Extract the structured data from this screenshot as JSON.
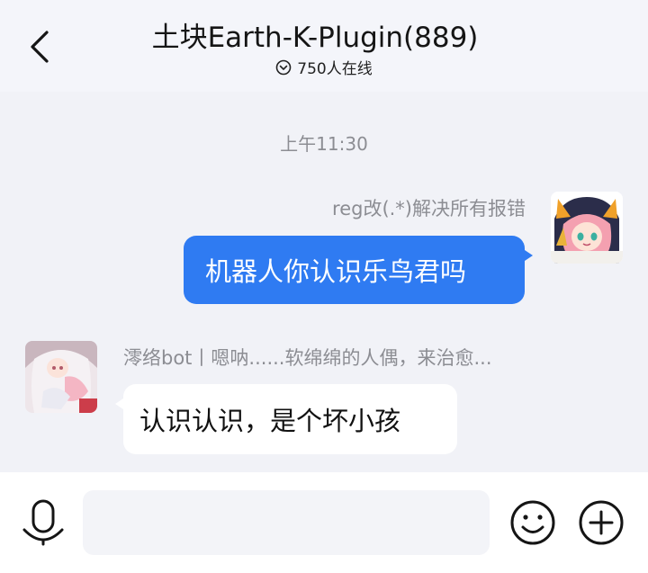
{
  "header": {
    "title": "土块Earth-K-Plugin(889)",
    "online": "750人在线",
    "back_icon": "back-arrow-icon",
    "online_icon": "chevron-down-circle-icon"
  },
  "chat": {
    "timestamp": "上午11:30",
    "messages": [
      {
        "side": "right",
        "sender": "reg改(.*)解决所有报错",
        "text": "机器人你认识乐鸟君吗",
        "bubble_color": "#2f7bf2"
      },
      {
        "side": "left",
        "sender": "澪络bot丨嗯呐......软绵绵的人偶，来治愈...",
        "text": "认识认识，是个坏小孩",
        "bubble_color": "#ffffff"
      }
    ]
  },
  "composer": {
    "value": "",
    "placeholder": "",
    "voice_icon": "microphone-icon",
    "emoji_icon": "smiley-icon",
    "more_icon": "plus-circle-icon"
  }
}
